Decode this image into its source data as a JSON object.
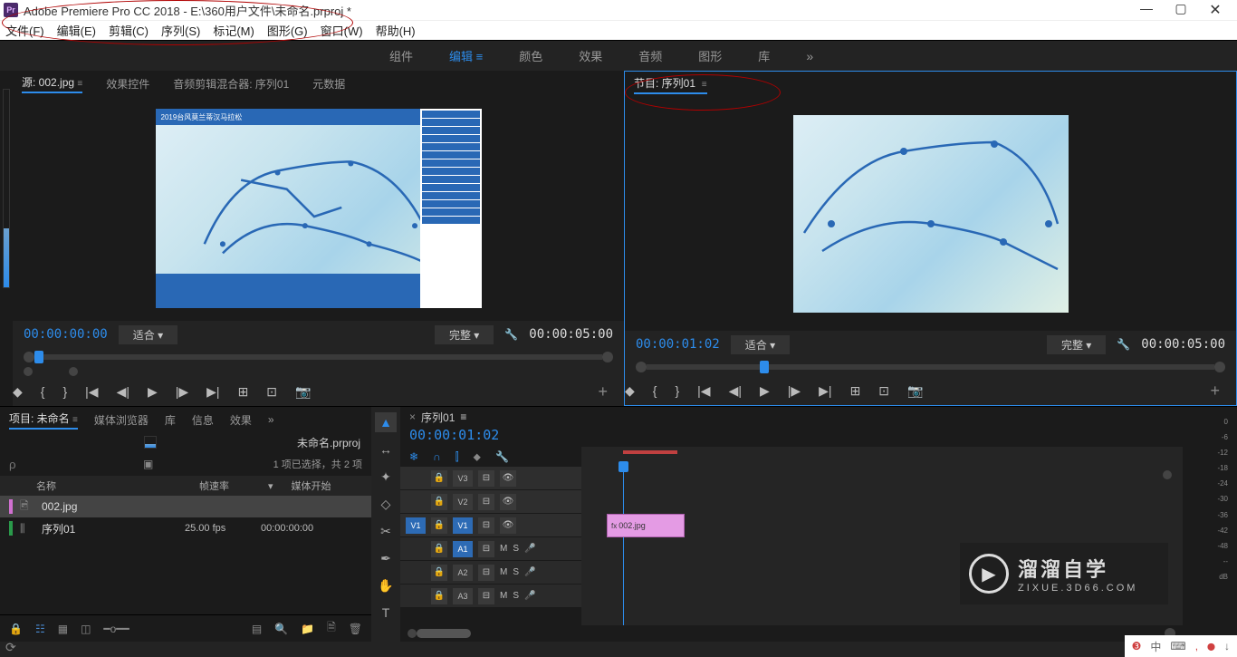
{
  "titlebar": {
    "icon_text": "Pr",
    "title": "Adobe Premiere Pro CC 2018 - E:\\360用户文件\\未命名.prproj *"
  },
  "menu": [
    "文件(F)",
    "编辑(E)",
    "剪辑(C)",
    "序列(S)",
    "标记(M)",
    "图形(G)",
    "窗口(W)",
    "帮助(H)"
  ],
  "workspaces": [
    "组件",
    "编辑",
    "颜色",
    "效果",
    "音频",
    "图形",
    "库"
  ],
  "workspace_active": "编辑",
  "workspace_more": "»",
  "source": {
    "tabs": [
      "源: 002.jpg",
      "效果控件",
      "音频剪辑混合器: 序列01",
      "元数据"
    ],
    "active_tab": "源: 002.jpg",
    "time_in": "00:00:00:00",
    "time_out": "00:00:05:00",
    "zoom": "适合",
    "quality": "完整"
  },
  "program": {
    "tab": "节目: 序列01",
    "time_in": "00:00:01:02",
    "time_out": "00:00:05:00",
    "zoom": "适合",
    "quality": "完整"
  },
  "project": {
    "tabs": [
      "项目: 未命名",
      "媒体浏览器",
      "库",
      "信息",
      "效果"
    ],
    "active_tab": "项目: 未命名",
    "filename_label": "未命名.prproj",
    "search_placeholder": "ρ",
    "stats": "1 项已选择，共 2 项",
    "columns": [
      "名称",
      "帧速率",
      "媒体开始"
    ],
    "items": [
      {
        "color": "#d070d0",
        "icon": "🖻",
        "name": "002.jpg",
        "fps": "",
        "start": "",
        "selected": true
      },
      {
        "color": "#2a9a4a",
        "icon": "⫼",
        "name": "序列01",
        "fps": "25.00 fps",
        "start": "00:00:00:00",
        "selected": false
      }
    ]
  },
  "timeline": {
    "tab": "序列01",
    "timecode": "00:00:01:02",
    "tracks": {
      "video": [
        "V3",
        "V2",
        "V1"
      ],
      "audio": [
        "A1",
        "A2",
        "A3"
      ]
    },
    "clip_name": "002.jpg",
    "snap_icons": [
      "❄",
      "∩",
      "⫿",
      "⬥",
      "🔧"
    ]
  },
  "tools": [
    "▶",
    "↔",
    "✦",
    "◇",
    "✂",
    "✒",
    "✋",
    "T"
  ],
  "transport_icons": [
    "◆",
    "{",
    "}",
    "|◀",
    "◀|",
    "▶",
    "|▶",
    "↗",
    "⊞",
    "⊡",
    "📷"
  ],
  "audio_levels": [
    "0",
    "-6",
    "-12",
    "-18",
    "-24",
    "-30",
    "-36",
    "-42",
    "-48",
    "--",
    "dB"
  ],
  "watermark": {
    "big": "溜溜自学",
    "small": "ZIXUE.3D66.COM"
  },
  "taskbar": [
    "❸",
    "中",
    "⌨",
    ",",
    "⬤",
    "↓"
  ]
}
